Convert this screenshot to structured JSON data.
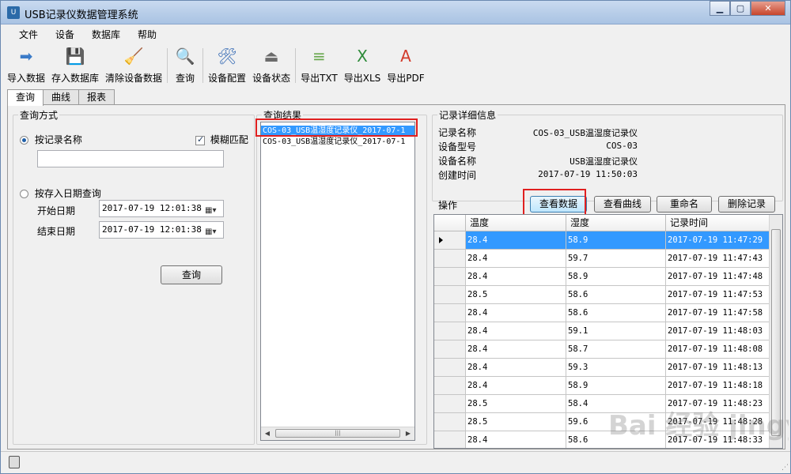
{
  "window": {
    "title": "USB记录仪数据管理系统",
    "minimize": "▁",
    "maximize": "▢",
    "close": "✕"
  },
  "menu": [
    "文件",
    "设备",
    "数据库",
    "帮助"
  ],
  "toolbar": [
    {
      "label": "导入数据",
      "icon": "import-arrow-icon",
      "color": "#3b7bc8",
      "glyph": "➡"
    },
    {
      "label": "存入数据库",
      "icon": "save-floppy-icon",
      "color": "#2d5fa6",
      "glyph": "💾"
    },
    {
      "label": "清除设备数据",
      "icon": "broom-icon",
      "color": "#e0b12a",
      "glyph": "🧹"
    },
    {
      "label": "查询",
      "icon": "magnifier-icon",
      "color": "#444444",
      "glyph": "🔍"
    },
    {
      "label": "设备配置",
      "icon": "tools-icon",
      "color": "#3c6fb6",
      "glyph": "🛠"
    },
    {
      "label": "设备状态",
      "icon": "usb-drive-icon",
      "color": "#6b6b6b",
      "glyph": "⏏"
    },
    {
      "label": "导出TXT",
      "icon": "txt-file-icon",
      "color": "#6aa84f",
      "glyph": "≡"
    },
    {
      "label": "导出XLS",
      "icon": "xls-file-icon",
      "color": "#2e8b3a",
      "glyph": "X"
    },
    {
      "label": "导出PDF",
      "icon": "pdf-file-icon",
      "color": "#d23a2a",
      "glyph": "A"
    }
  ],
  "tabs": [
    "查询",
    "曲线",
    "报表"
  ],
  "query": {
    "group_title": "查询方式",
    "by_name_label": "按记录名称",
    "fuzzy_label": "模糊匹配",
    "name_value": "",
    "by_date_label": "按存入日期查询",
    "start_label": "开始日期",
    "start_value": "2017-07-19 12:01:38",
    "end_label": "结束日期",
    "end_value": "2017-07-19 12:01:38",
    "button": "查询"
  },
  "results": {
    "group_title": "查询结果",
    "items": [
      "COS-03_USB温湿度记录仪_2017-07-1",
      "COS-03_USB温湿度记录仪_2017-07-1"
    ]
  },
  "detail": {
    "group_title": "记录详细信息",
    "fields": [
      {
        "label": "记录名称",
        "value": "COS-03_USB温湿度记录仪"
      },
      {
        "label": "设备型号",
        "value": "COS-03"
      },
      {
        "label": "设备名称",
        "value": "USB温湿度记录仪"
      },
      {
        "label": "创建时间",
        "value": "2017-07-19 11:50:03"
      }
    ],
    "ops_label": "操作",
    "buttons": [
      "查看数据",
      "查看曲线",
      "重命名",
      "删除记录"
    ]
  },
  "grid": {
    "headers": [
      "温度",
      "湿度",
      "记录时间"
    ],
    "rows": [
      [
        "28.4",
        "58.9",
        "2017-07-19 11:47:29"
      ],
      [
        "28.4",
        "59.7",
        "2017-07-19 11:47:43"
      ],
      [
        "28.4",
        "58.9",
        "2017-07-19 11:47:48"
      ],
      [
        "28.5",
        "58.6",
        "2017-07-19 11:47:53"
      ],
      [
        "28.4",
        "58.6",
        "2017-07-19 11:47:58"
      ],
      [
        "28.4",
        "59.1",
        "2017-07-19 11:48:03"
      ],
      [
        "28.4",
        "58.7",
        "2017-07-19 11:48:08"
      ],
      [
        "28.4",
        "59.3",
        "2017-07-19 11:48:13"
      ],
      [
        "28.4",
        "58.9",
        "2017-07-19 11:48:18"
      ],
      [
        "28.5",
        "58.4",
        "2017-07-19 11:48:23"
      ],
      [
        "28.5",
        "59.6",
        "2017-07-19 11:48:28"
      ],
      [
        "28.4",
        "58.6",
        "2017-07-19 11:48:33"
      ]
    ]
  },
  "watermark": "Bai 经验 jingyan.baidu.com"
}
